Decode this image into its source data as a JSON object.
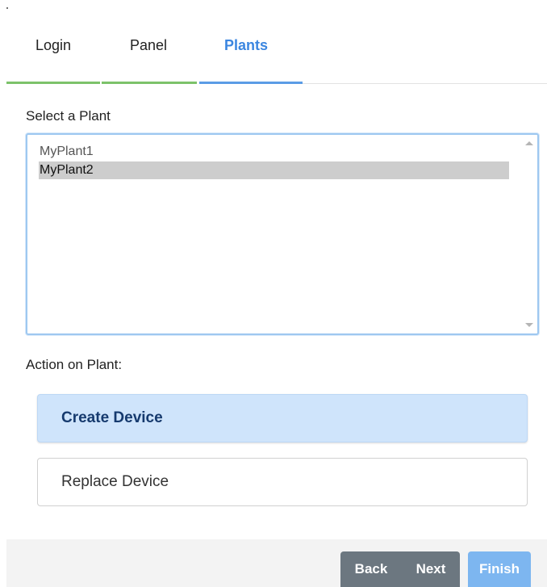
{
  "tabs": [
    {
      "label": "Login",
      "state": "completed"
    },
    {
      "label": "Panel",
      "state": "completed"
    },
    {
      "label": "Plants",
      "state": "active"
    }
  ],
  "plant_select": {
    "label": "Select a Plant",
    "options": [
      "MyPlant1",
      "MyPlant2"
    ],
    "selected": "MyPlant2"
  },
  "action": {
    "label": "Action on Plant:",
    "options": [
      {
        "label": "Create Device",
        "selected": true
      },
      {
        "label": "Replace Device",
        "selected": false
      }
    ]
  },
  "footer": {
    "back": "Back",
    "next": "Next",
    "finish": "Finish"
  },
  "colors": {
    "active_tab": "#3b86e0",
    "completed_tab_line": "#7cc26a",
    "selected_action_bg": "#cfe4fb",
    "nav_button_bg": "#6c7780",
    "finish_button_bg": "#7db6f0"
  }
}
